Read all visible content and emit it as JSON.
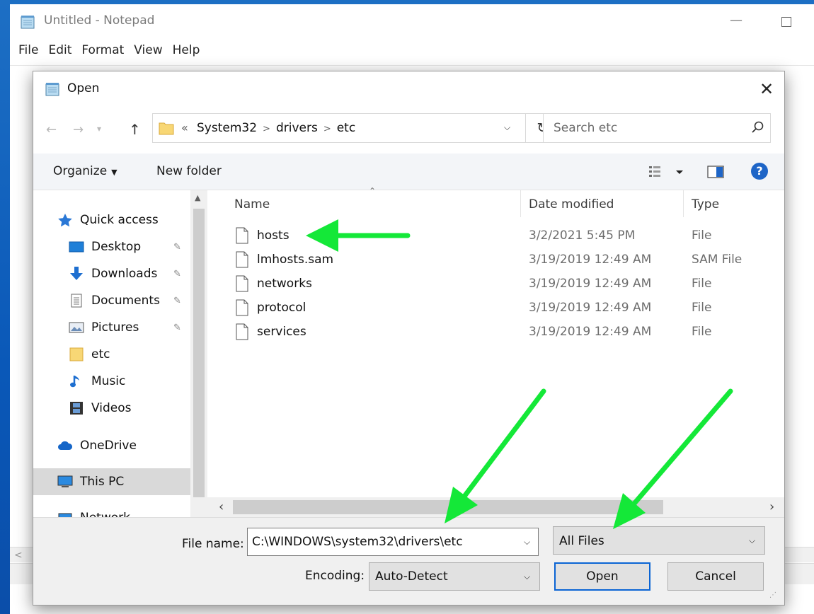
{
  "notepad": {
    "title": "Untitled - Notepad",
    "menu": [
      "File",
      "Edit",
      "Format",
      "View",
      "Help"
    ],
    "minimize_glyph": "—"
  },
  "dialog": {
    "title": "Open",
    "close_glyph": "✕",
    "address": {
      "prefix": "«",
      "segments": [
        "System32",
        "drivers",
        "etc"
      ]
    },
    "search": {
      "placeholder": "Search etc"
    },
    "toolbar": {
      "organize": "Organize",
      "new_folder": "New folder"
    },
    "nav_pane": [
      {
        "label": "Quick access",
        "icon": "star-icon",
        "pinned": false
      },
      {
        "label": "Desktop",
        "icon": "desktop-icon",
        "pinned": true
      },
      {
        "label": "Downloads",
        "icon": "download-arrow-icon",
        "pinned": true
      },
      {
        "label": "Documents",
        "icon": "documents-icon",
        "pinned": true
      },
      {
        "label": "Pictures",
        "icon": "pictures-icon",
        "pinned": true
      },
      {
        "label": "etc",
        "icon": "folder-icon",
        "pinned": false
      },
      {
        "label": "Music",
        "icon": "music-note-icon",
        "pinned": false
      },
      {
        "label": "Videos",
        "icon": "film-icon",
        "pinned": false
      },
      {
        "label": "OneDrive",
        "icon": "cloud-icon",
        "pinned": false
      },
      {
        "label": "This PC",
        "icon": "computer-icon",
        "pinned": false,
        "selected": true
      },
      {
        "label": "Network",
        "icon": "network-icon",
        "pinned": false
      }
    ],
    "columns": {
      "name": "Name",
      "date": "Date modified",
      "type": "Type"
    },
    "files": [
      {
        "name": "hosts",
        "date": "3/2/2021 5:45 PM",
        "type": "File"
      },
      {
        "name": "lmhosts.sam",
        "date": "3/19/2019 12:49 AM",
        "type": "SAM File"
      },
      {
        "name": "networks",
        "date": "3/19/2019 12:49 AM",
        "type": "File"
      },
      {
        "name": "protocol",
        "date": "3/19/2019 12:49 AM",
        "type": "File"
      },
      {
        "name": "services",
        "date": "3/19/2019 12:49 AM",
        "type": "File"
      }
    ],
    "bottom": {
      "file_name_label": "File name:",
      "file_name_value": "C:\\WINDOWS\\system32\\drivers\\etc",
      "file_type": "All Files",
      "encoding_label": "Encoding:",
      "encoding_value": "Auto-Detect",
      "open_label": "Open",
      "cancel_label": "Cancel"
    }
  },
  "colors": {
    "desktop_blue": "#0a58b8",
    "annotation_arrow": "#14e838",
    "help_blue": "#1e65c7",
    "default_button_border": "#0a64d4"
  }
}
